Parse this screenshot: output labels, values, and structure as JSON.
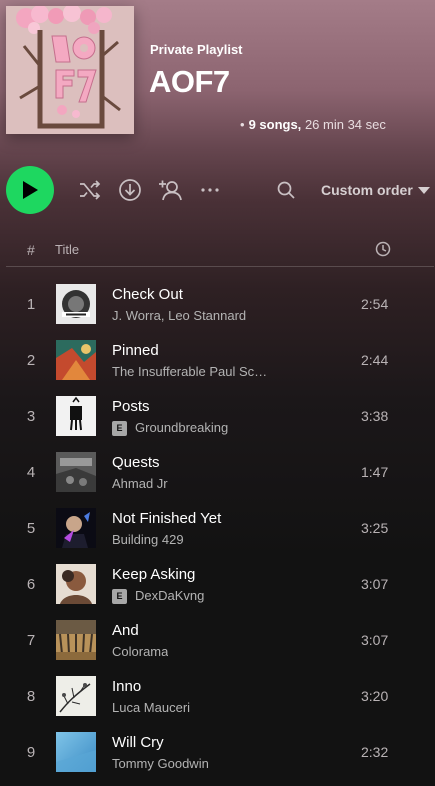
{
  "playlist": {
    "type_label": "Private Playlist",
    "title": "AOF7",
    "cover_text": "AOF7",
    "meta_dot": "•",
    "songs_count": "9 songs,",
    "duration": "26 min 34 sec"
  },
  "actions": {
    "play_icon": "play-icon",
    "shuffle_icon": "shuffle-icon",
    "download_icon": "download-icon",
    "add_user_icon": "add-user-icon",
    "more_icon": "more-icon",
    "search_icon": "search-icon",
    "sort_label": "Custom order",
    "accent_color": "#1ed760"
  },
  "table_header": {
    "number": "#",
    "title": "Title",
    "duration_icon": "clock-icon"
  },
  "tracks": [
    {
      "number": "1",
      "title": "Check Out",
      "artist": "J. Worra, Leo Stannard",
      "explicit": false,
      "duration": "2:54"
    },
    {
      "number": "2",
      "title": "Pinned",
      "artist": "The Insufferable Paul Sc…",
      "explicit": false,
      "duration": "2:44"
    },
    {
      "number": "3",
      "title": "Posts",
      "artist": "Groundbreaking",
      "explicit": true,
      "explicit_label": "E",
      "duration": "3:38"
    },
    {
      "number": "4",
      "title": "Quests",
      "artist": "Ahmad Jr",
      "explicit": false,
      "duration": "1:47"
    },
    {
      "number": "5",
      "title": "Not Finished Yet",
      "artist": "Building 429",
      "explicit": false,
      "duration": "3:25"
    },
    {
      "number": "6",
      "title": "Keep Asking",
      "artist": "DexDaKvng",
      "explicit": true,
      "explicit_label": "E",
      "duration": "3:07"
    },
    {
      "number": "7",
      "title": "And",
      "artist": "Colorama",
      "explicit": false,
      "duration": "3:07"
    },
    {
      "number": "8",
      "title": "Inno",
      "artist": "Luca Mauceri",
      "explicit": false,
      "duration": "3:20"
    },
    {
      "number": "9",
      "title": "Will Cry",
      "artist": "Tommy Goodwin",
      "explicit": false,
      "duration": "2:32"
    }
  ]
}
